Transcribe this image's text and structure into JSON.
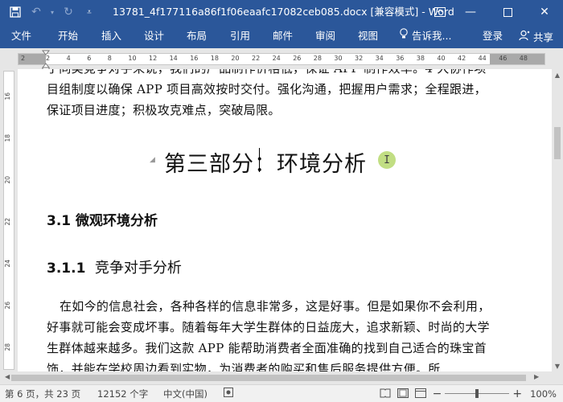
{
  "titlebar": {
    "title": "13781_4f177116a86f1f06eaafc17082ceb085.docx [兼容模式] - Word",
    "icons": [
      "save-icon",
      "undo-icon",
      "redo-icon",
      "customize-icon"
    ],
    "controls": [
      "ribbon-display-icon",
      "minimize-icon",
      "restore-icon",
      "close-icon"
    ]
  },
  "ribbon": {
    "tabs": [
      "文件",
      "开始",
      "插入",
      "设计",
      "布局",
      "引用",
      "邮件",
      "审阅",
      "视图"
    ],
    "tellme": "告诉我...",
    "signin": "登录",
    "share": "共享"
  },
  "ruler": {
    "numbers": [
      "2",
      "2",
      "4",
      "6",
      "8",
      "10",
      "12",
      "14",
      "16",
      "18",
      "20",
      "22",
      "24",
      "26",
      "28",
      "30",
      "32",
      "34",
      "36",
      "38",
      "40",
      "42",
      "44",
      "46",
      "48"
    ]
  },
  "vruler": {
    "numbers": [
      "16",
      "18",
      "20",
      "22",
      "24",
      "26",
      "28"
    ]
  },
  "document": {
    "p1": "于同类竞争对手来说，我们的产品制作价格低，保证 APP 制作效率。4 大协作项目组制度以确保 APP 项目高效按时交付。强化沟通，把握用户需求；全程跟进，保证项目进度；积极攻克难点，突破局限。",
    "heading1_a": "第三部分",
    "heading1_b": "：环境分析",
    "h2": "3.1  微观环境分析",
    "h3_num": "3.1.1",
    "h3_text": "竞争对手分析",
    "p2": "在如今的信息社会，各种各样的信息非常多，这是好事。但是如果你不会利用，好事就可能会变成坏事。随着每年大学生群体的日益庞大，追求新颖、时尚的大学生群体越来越多。我们这款 APP 能帮助消费者全面准确的找到自己适合的珠宝首饰，并能在学校周边看到实物，为消费者的购买和售后服务提供方便。所"
  },
  "status": {
    "page": "第 6 页，共 23 页",
    "words": "12152 个字",
    "language": "中文(中国)",
    "zoom": "100%",
    "zoom_minus": "−",
    "zoom_plus": "+"
  }
}
